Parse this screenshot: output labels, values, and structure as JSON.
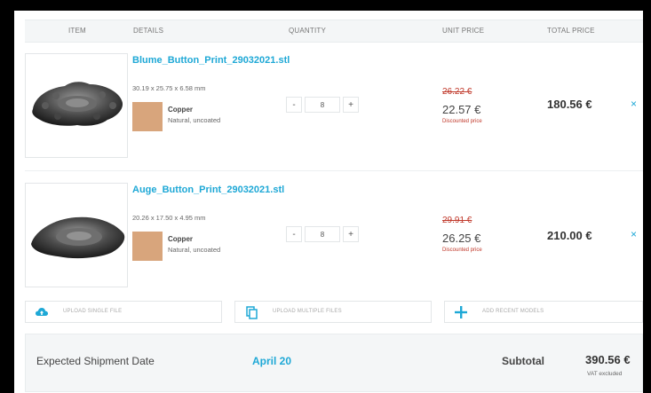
{
  "table_header": {
    "item": "ITEM",
    "details": "DETAILS",
    "quantity": "QUANTITY",
    "unit_price": "UNIT PRICE",
    "total_price": "TOTAL PRICE"
  },
  "items": [
    {
      "filename": "Blume_Button_Print_29032021.stl",
      "dimensions": "30.19 x 25.75 x 6.58 mm",
      "material": "Copper",
      "finish": "Natural, uncoated",
      "quantity": "8",
      "old_price": "26.22 €",
      "unit_price": "22.57 €",
      "discount_label": "Discounted price",
      "total_price": "180.56 €",
      "remove_icon": "×"
    },
    {
      "filename": "Auge_Button_Print_29032021.stl",
      "dimensions": "20.26 x 17.50 x 4.95 mm",
      "material": "Copper",
      "finish": "Natural, uncoated",
      "quantity": "8",
      "old_price": "29.91 €",
      "unit_price": "26.25 €",
      "discount_label": "Discounted price",
      "total_price": "210.00 €",
      "remove_icon": "×"
    }
  ],
  "qty_controls": {
    "minus": "-",
    "plus": "+"
  },
  "upload": {
    "single": "UPLOAD SINGLE FILE",
    "multiple": "UPLOAD MULTIPLE FILES",
    "recent": "ADD RECENT MODELS"
  },
  "summary": {
    "ship_label": "Expected Shipment Date",
    "ship_date": "April 20",
    "subtotal_label": "Subtotal",
    "subtotal_value": "390.56 €",
    "vat_note": "VAT excluded"
  },
  "colors": {
    "accent": "#1ea8d6",
    "discount": "#c0392b",
    "copper_swatch": "#d8a57c"
  }
}
